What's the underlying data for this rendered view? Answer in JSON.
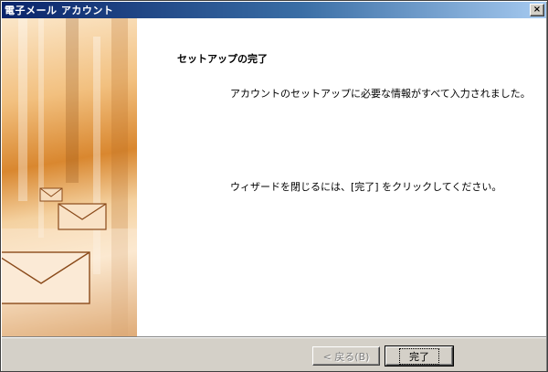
{
  "window": {
    "title": "電子メール アカウント",
    "close_glyph": "×"
  },
  "page": {
    "title": "セットアップの完了",
    "message1": "アカウントのセットアップに必要な情報がすべて入力されました。",
    "message2": "ウィザードを閉じるには、[完了] をクリックしてください。"
  },
  "buttons": {
    "back_label": "< 戻る(B)",
    "finish_label": "完了"
  },
  "colors": {
    "titlebar_start": "#0a246a",
    "titlebar_end": "#a6caf0",
    "dialog_face": "#d4d0c8",
    "banner_accent": "#d9872f"
  }
}
